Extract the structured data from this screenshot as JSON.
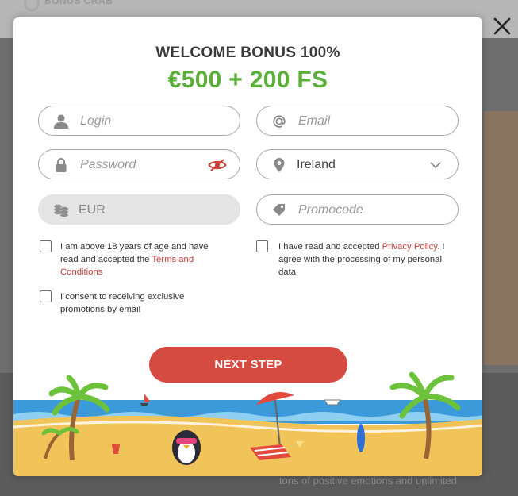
{
  "background": {
    "brand_label": "BONUS CRAB",
    "bottom_text": "tons of positive emotions and unlimited"
  },
  "modal": {
    "title": "WELCOME BONUS 100%",
    "bonus": "€500 + 200 FS",
    "fields": {
      "login": {
        "placeholder": "Login",
        "icon": "user-icon"
      },
      "email": {
        "placeholder": "Email",
        "icon": "at-sign-icon"
      },
      "password": {
        "placeholder": "Password",
        "icon": "lock-icon",
        "toggle_icon": "eye-hidden-icon"
      },
      "country": {
        "value": "Ireland",
        "icon": "location-pin-icon"
      },
      "currency": {
        "value": "EUR",
        "icon": "coins-icon"
      },
      "promocode": {
        "placeholder": "Promocode",
        "icon": "tag-icon"
      }
    },
    "checkboxes": {
      "age": {
        "text": "I am above 18 years of age and have read and accepted the ",
        "link": "Terms and Conditions",
        "checked": false
      },
      "privacy": {
        "text_before": "I have read and accepted ",
        "link": "Privacy Policy.",
        "text_after": " I agree with the processing of my personal data",
        "checked": false
      },
      "promo": {
        "text": "I consent to receiving exclusive promotions by email",
        "checked": false
      }
    },
    "next_label": "NEXT STEP"
  },
  "colors": {
    "accent_green": "#5aae39",
    "button_red": "#d54a41",
    "link_red": "#c7423c"
  }
}
